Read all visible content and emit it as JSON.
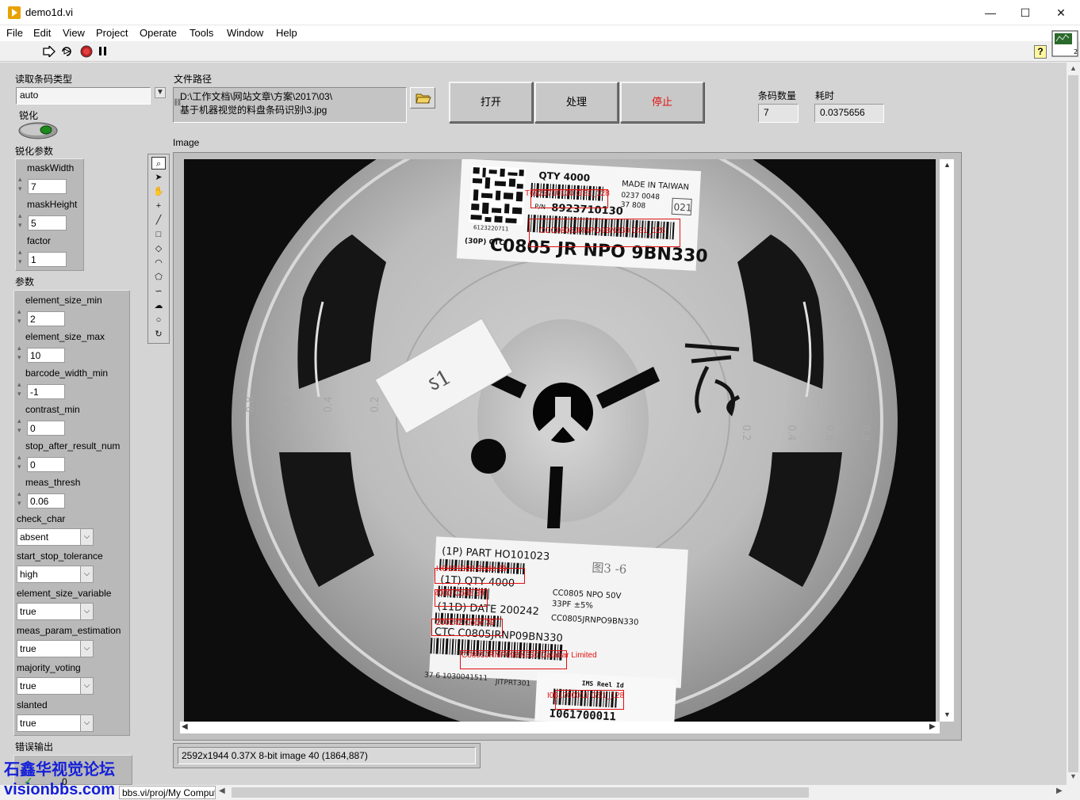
{
  "window": {
    "title": "demo1d.vi",
    "minimize": "—",
    "maximize": "☐",
    "close": "✕"
  },
  "menu": [
    "File",
    "Edit",
    "View",
    "Project",
    "Operate",
    "Tools",
    "Window",
    "Help"
  ],
  "left": {
    "barcode_type_label": "读取条码类型",
    "barcode_type_value": "auto",
    "sharpen_label": "锐化",
    "sharpen_params_label": "锐化参数",
    "sharpen_params": [
      {
        "name": "maskWidth",
        "value": "7"
      },
      {
        "name": "maskHeight",
        "value": "5"
      },
      {
        "name": "factor",
        "value": "1"
      }
    ],
    "params_label": "参数",
    "numeric_params": [
      {
        "name": "element_size_min",
        "value": "2"
      },
      {
        "name": "element_size_max",
        "value": "10"
      },
      {
        "name": "barcode_width_min",
        "value": "-1"
      },
      {
        "name": "contrast_min",
        "value": "0"
      },
      {
        "name": "stop_after_result_num",
        "value": "0"
      },
      {
        "name": "meas_thresh",
        "value": "0.06"
      }
    ],
    "ring_params": [
      {
        "name": "check_char",
        "value": "absent"
      },
      {
        "name": "start_stop_tolerance",
        "value": "high"
      },
      {
        "name": "element_size_variable",
        "value": "true"
      },
      {
        "name": "meas_param_estimation",
        "value": "true"
      },
      {
        "name": "majority_voting",
        "value": "true"
      },
      {
        "name": "slanted",
        "value": "true"
      }
    ],
    "error_out_label": "错误输出",
    "error_status": "✓",
    "error_code": "0"
  },
  "file_path": {
    "label": "文件路径",
    "line1": "D:\\工作文档\\网站文章\\方案\\2017\\03\\",
    "line2": "基于机器视觉的料盘条码识别\\3.jpg"
  },
  "buttons": {
    "open": "打开",
    "process": "处理",
    "stop": "停止"
  },
  "indicators": {
    "count_label": "条码数量",
    "count_value": "7",
    "time_label": "耗时",
    "time_value": "0.0375656"
  },
  "image": {
    "label": "Image",
    "status": "2592x1944 0.37X 8-bit image 40    (1864,887)",
    "reel_label_top": {
      "qty": "QTY 4000",
      "made_in": "MADE IN TAIWAN",
      "code1": "0237   0048",
      "code2": "37 808",
      "box": "021",
      "pn": "8923710130",
      "pn_prefix": "P/N",
      "small": "6123220711",
      "part": "C0805 JR NPO 9BN330",
      "part_prefix": "(30P) CTC"
    },
    "reel_label_bottom": {
      "part": "(1P) PART HO101023",
      "qty": "(1T) QTY 4000",
      "date": "(11D) DATE 200242",
      "ctc": "CTC C0805JRNP09BN330",
      "spec1": "CC0805   NPO   50V",
      "spec2": "33PF    ±5%",
      "spec3": "CC0805JRNPO9BN330",
      "lot": "37 6 1030041511",
      "lot2": "JITPRT301",
      "reel_id_title": "IMS Reel Id",
      "reel_id": "I061700011",
      "handwriting": "图3 -6"
    },
    "results": [
      {
        "text": "T6923710130 GS1_128"
      },
      {
        "text": "CCC0805JRNPO9BN330 GS1_128"
      },
      {
        "text": "HO101023 Code 39"
      },
      {
        "text": "4000 Code 39"
      },
      {
        "text": "200242 Code 39"
      },
      {
        "text": "C0805JRNP09BN330 Databar Limited"
      },
      {
        "text": "I061700011 GS1_128"
      }
    ],
    "reel_scale": [
      "0.8",
      "0.6",
      "0.4",
      "0.2",
      "0.8",
      "0.6",
      "0.4",
      "0.2"
    ]
  },
  "bottom": {
    "path": "bbs.vi/proj/My Computer",
    "watermark1": "石鑫华视觉论坛",
    "watermark2": "visionbbs.com"
  },
  "colors": {
    "accent_red": "#e01010",
    "stop_text": "#e41010",
    "watermark": "#1520d8"
  }
}
